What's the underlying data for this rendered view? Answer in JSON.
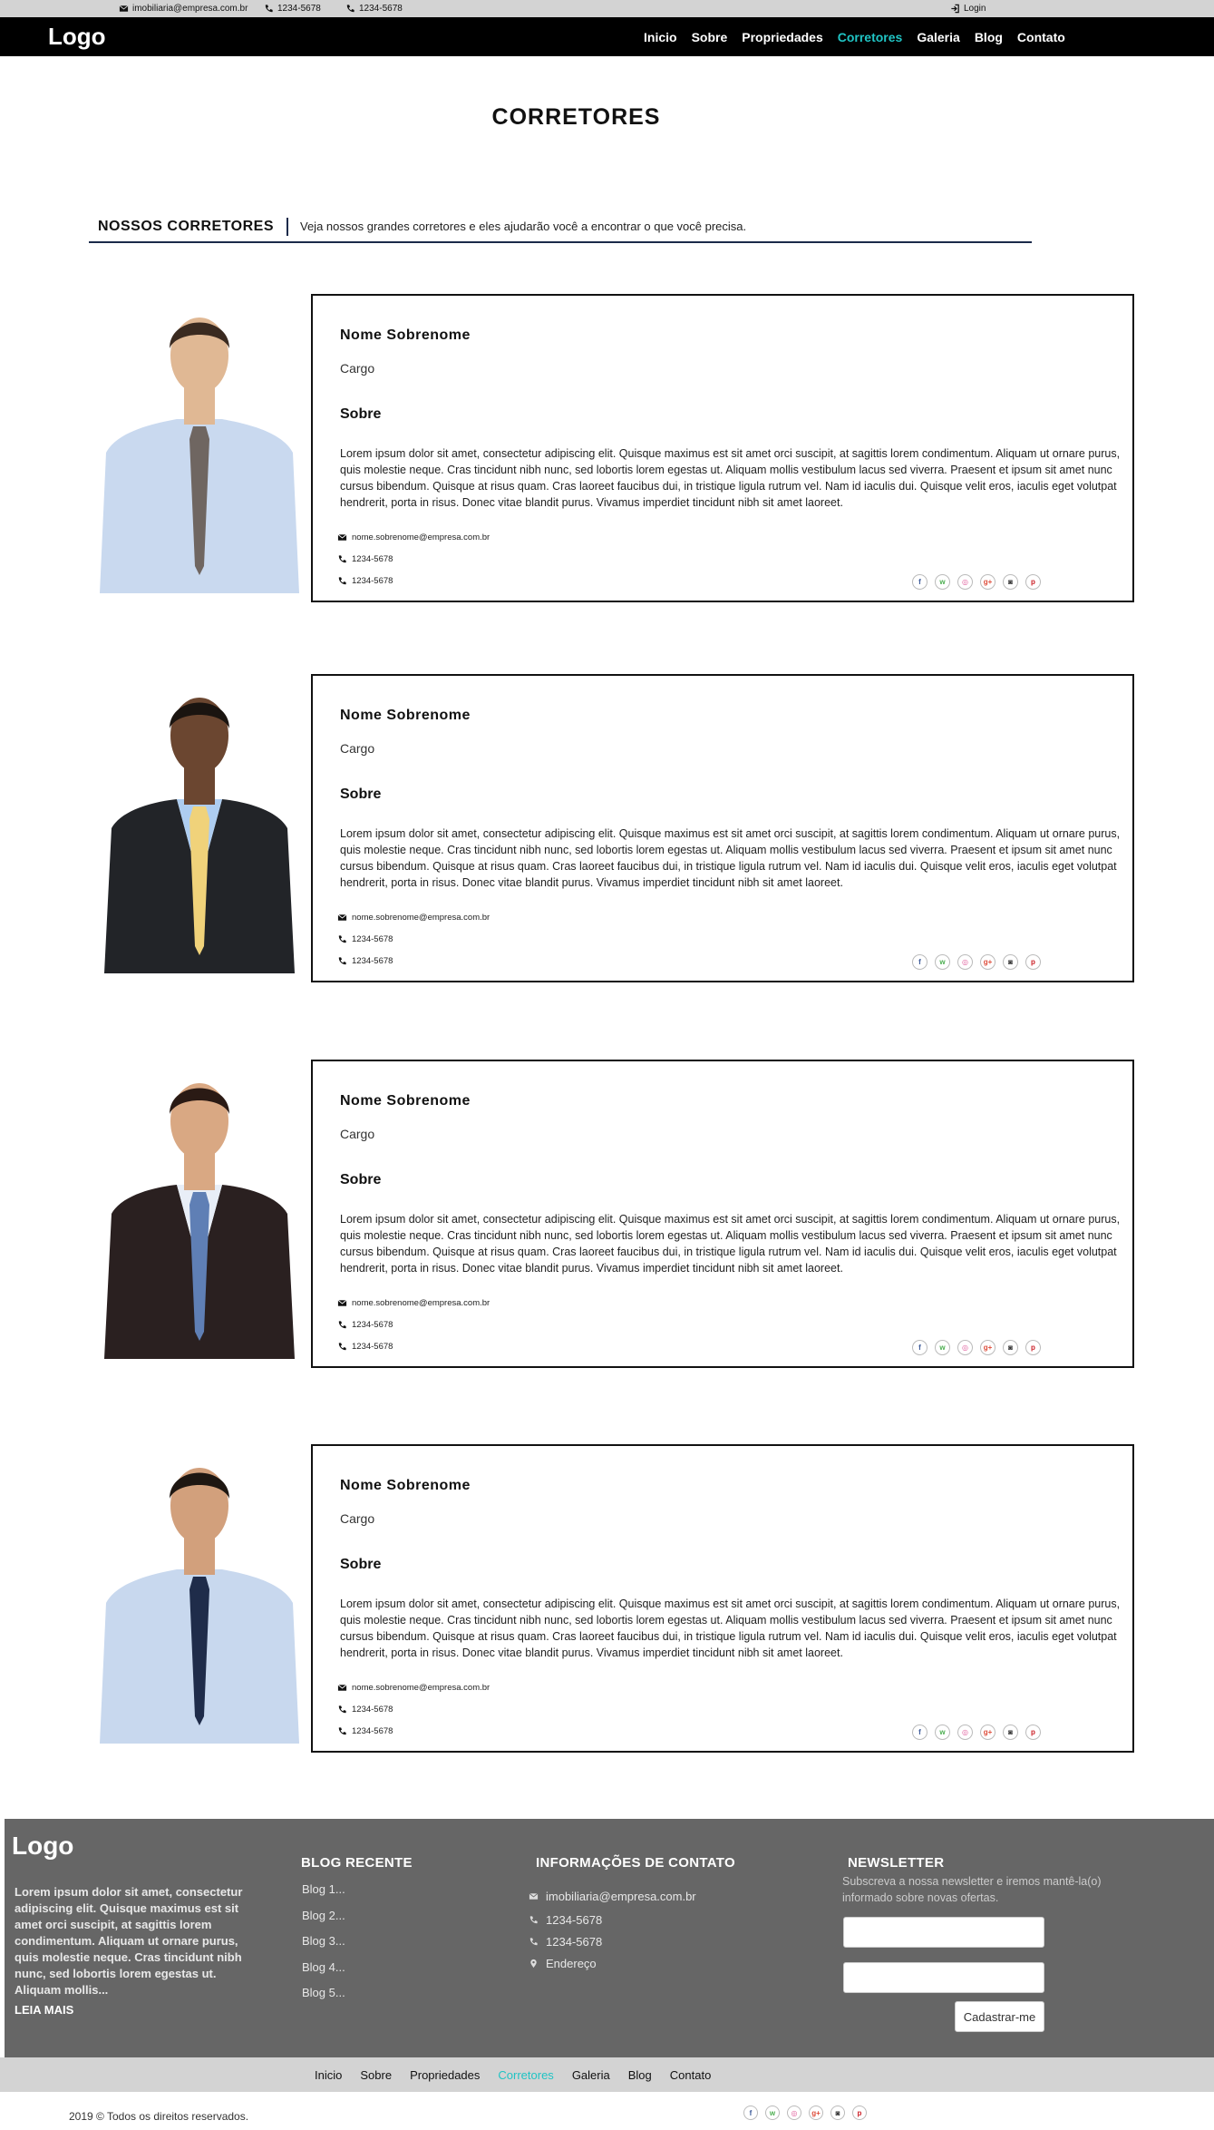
{
  "topbar": {
    "email": "imobiliaria@empresa.com.br",
    "phone1": "1234-5678",
    "phone2": "1234-5678",
    "login": "Login"
  },
  "nav": {
    "logo": "Logo",
    "items": [
      {
        "label": "Inicio"
      },
      {
        "label": "Sobre"
      },
      {
        "label": "Propriedades"
      },
      {
        "label": "Corretores",
        "active": true
      },
      {
        "label": "Galeria"
      },
      {
        "label": "Blog"
      },
      {
        "label": "Contato"
      }
    ]
  },
  "page": {
    "title": "CORRETORES",
    "section_title": "NOSSOS CORRETORES",
    "section_desc": "Veja nossos grandes corretores e eles ajudarão você a encontrar o que você precisa."
  },
  "agents": [
    {
      "name": "Nome Sobrenome",
      "role": "Cargo",
      "about_title": "Sobre",
      "about": "Lorem ipsum dolor sit amet, consectetur adipiscing elit. Quisque maximus est sit amet orci suscipit, at sagittis lorem condimentum. Aliquam ut ornare purus, quis molestie neque.  Cras tincidunt nibh nunc, sed lobortis lorem egestas ut. Aliquam mollis vestibulum lacus sed viverra. Praesent et ipsum sit amet nunc cursus bibendum. Quisque at risus quam. Cras laoreet faucibus dui, in tristique ligula rutrum vel. Nam id iaculis dui. Quisque velit eros, iaculis eget volutpat hendrerit, porta in risus. Donec vitae blandit purus. Vivamus imperdiet tincidunt nibh sit amet laoreet.",
      "email": "nome.sobrenome@empresa.com.br",
      "phone1": "1234-5678",
      "phone2": "1234-5678"
    },
    {
      "name": "Nome Sobrenome",
      "role": "Cargo",
      "about_title": "Sobre",
      "about": "Lorem ipsum dolor sit amet, consectetur adipiscing elit. Quisque maximus est sit amet orci suscipit, at sagittis lorem condimentum. Aliquam ut ornare purus, quis molestie neque.  Cras tincidunt nibh nunc, sed lobortis lorem egestas ut. Aliquam mollis vestibulum lacus sed viverra. Praesent et ipsum sit amet nunc cursus bibendum. Quisque at risus quam. Cras laoreet faucibus dui, in tristique ligula rutrum vel. Nam id iaculis dui. Quisque velit eros, iaculis eget volutpat hendrerit, porta in risus. Donec vitae blandit purus. Vivamus imperdiet tincidunt nibh sit amet laoreet.",
      "email": "nome.sobrenome@empresa.com.br",
      "phone1": "1234-5678",
      "phone2": "1234-5678"
    },
    {
      "name": "Nome Sobrenome",
      "role": "Cargo",
      "about_title": "Sobre",
      "about": "Lorem ipsum dolor sit amet, consectetur adipiscing elit. Quisque maximus est sit amet orci suscipit, at sagittis lorem condimentum. Aliquam ut ornare purus, quis molestie neque.  Cras tincidunt nibh nunc, sed lobortis lorem egestas ut. Aliquam mollis vestibulum lacus sed viverra. Praesent et ipsum sit amet nunc cursus bibendum. Quisque at risus quam. Cras laoreet faucibus dui, in tristique ligula rutrum vel. Nam id iaculis dui. Quisque velit eros, iaculis eget volutpat hendrerit, porta in risus. Donec vitae blandit purus. Vivamus imperdiet tincidunt nibh sit amet laoreet.",
      "email": "nome.sobrenome@empresa.com.br",
      "phone1": "1234-5678",
      "phone2": "1234-5678"
    },
    {
      "name": "Nome Sobrenome",
      "role": "Cargo",
      "about_title": "Sobre",
      "about": "Lorem ipsum dolor sit amet, consectetur adipiscing elit. Quisque maximus est sit amet orci suscipit, at sagittis lorem condimentum. Aliquam ut ornare purus, quis molestie neque.  Cras tincidunt nibh nunc, sed lobortis lorem egestas ut. Aliquam mollis vestibulum lacus sed viverra. Praesent et ipsum sit amet nunc cursus bibendum. Quisque at risus quam. Cras laoreet faucibus dui, in tristique ligula rutrum vel. Nam id iaculis dui. Quisque velit eros, iaculis eget volutpat hendrerit, porta in risus. Donec vitae blandit purus. Vivamus imperdiet tincidunt nibh sit amet laoreet.",
      "email": "nome.sobrenome@empresa.com.br",
      "phone1": "1234-5678",
      "phone2": "1234-5678"
    }
  ],
  "social_icons": [
    {
      "name": "facebook-icon",
      "glyph": "f",
      "color": "#3b5998"
    },
    {
      "name": "whatsapp-icon",
      "glyph": "w",
      "color": "#4caf50"
    },
    {
      "name": "dribbble-icon",
      "glyph": "◎",
      "color": "#e05b9b"
    },
    {
      "name": "google-plus-icon",
      "glyph": "g+",
      "color": "#dd4b39"
    },
    {
      "name": "instagram-icon",
      "glyph": "◙",
      "color": "#333333"
    },
    {
      "name": "pinterest-icon",
      "glyph": "p",
      "color": "#cb2027"
    }
  ],
  "footer": {
    "logo": "Logo",
    "about": "Lorem ipsum dolor sit amet, consectetur adipiscing elit. Quisque maximus est sit amet orci suscipit, at sagittis lorem condimentum. Aliquam ut ornare purus, quis molestie neque. Cras tincidunt nibh nunc, sed lobortis lorem egestas ut. Aliquam mollis...",
    "read_more": "LEIA MAIS",
    "blog_title": "BLOG RECENTE",
    "blog_items": [
      "Blog 1...",
      "Blog 2...",
      "Blog 3...",
      "Blog 4...",
      "Blog 5..."
    ],
    "contact_title": "INFORMAÇÕES DE CONTATO",
    "contact_email": "imobiliaria@empresa.com.br",
    "contact_phone1": "1234-5678",
    "contact_phone2": "1234-5678",
    "contact_address": "Endereço",
    "newsletter_title": "NEWSLETTER",
    "newsletter_text": "Subscreva a nossa newsletter e iremos mantê-la(o) informado sobre novas ofertas.",
    "newsletter_button": "Cadastrar-me"
  },
  "copyright": "2019 © Todos os direitos reservados.",
  "colors": {
    "accent": "#20c4c4",
    "navbar": "#000000",
    "footer": "#666666",
    "topbar": "#d3d3d3"
  }
}
